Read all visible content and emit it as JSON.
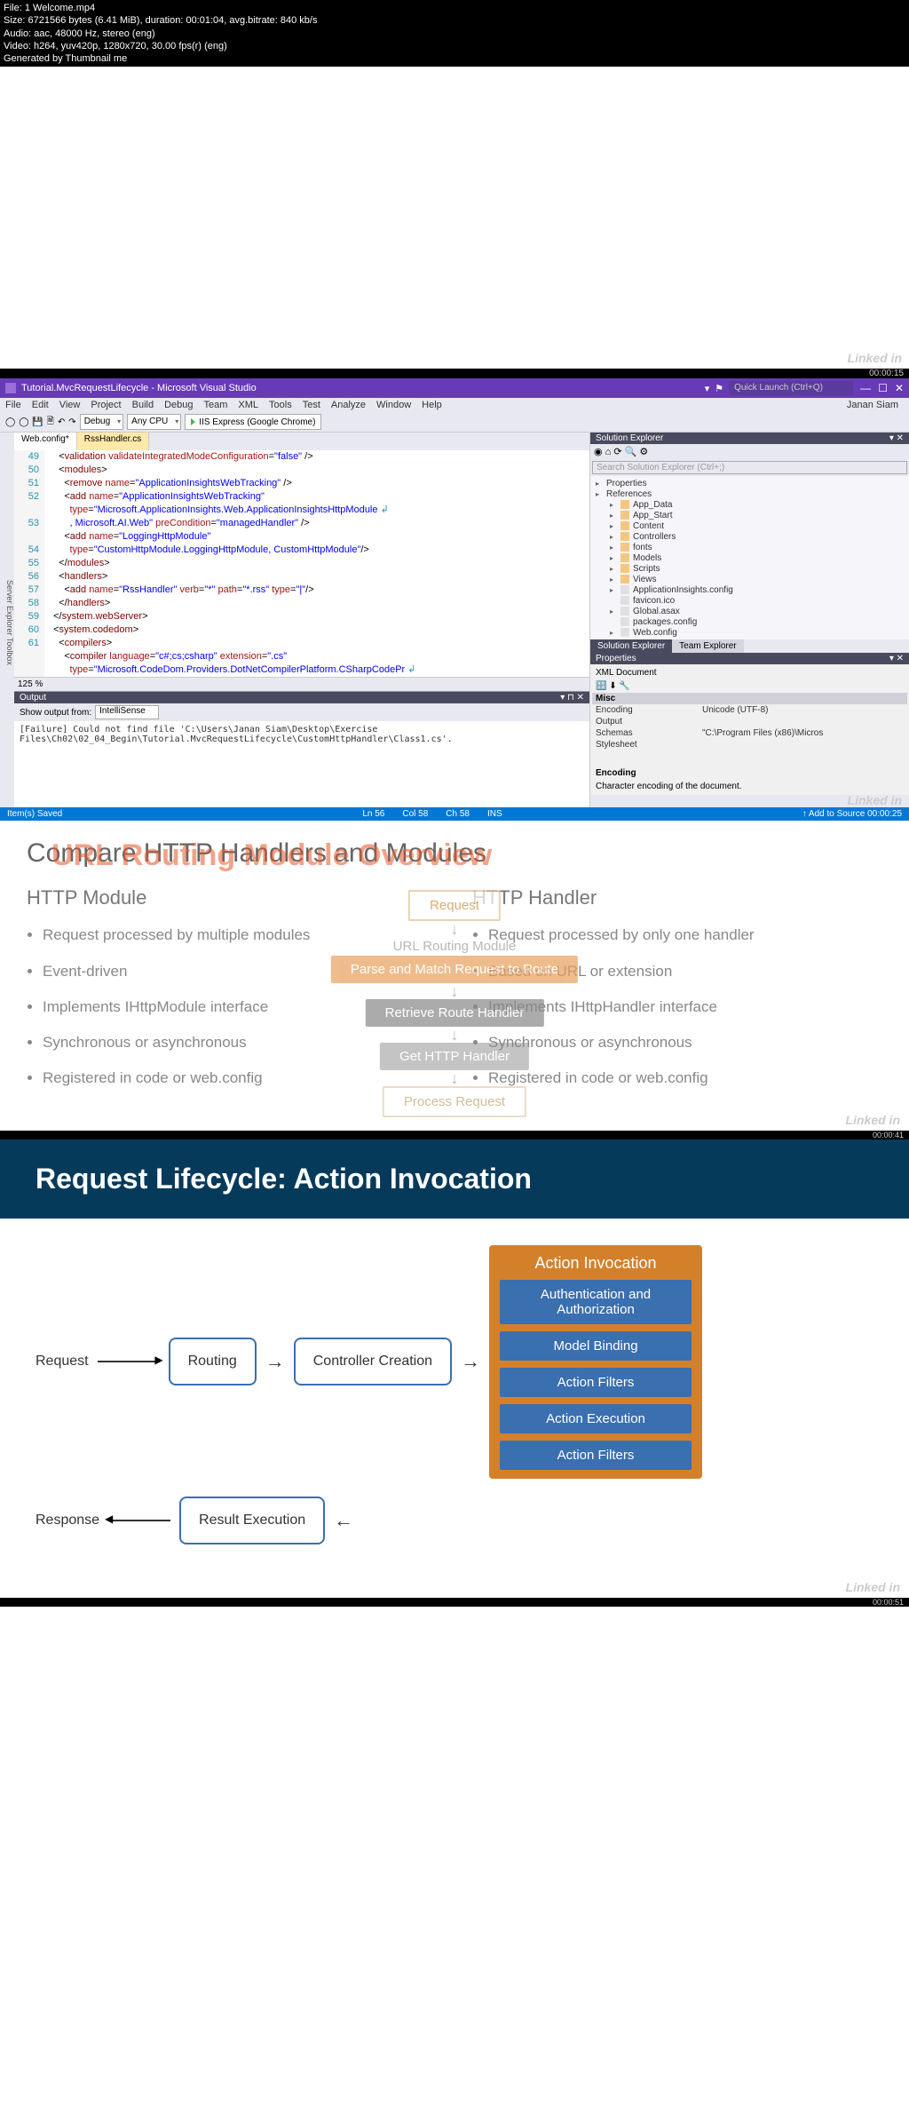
{
  "meta": {
    "file": "File: 1 Welcome.mp4",
    "size": "Size: 6721566 bytes (6.41 MiB), duration: 00:01:04, avg.bitrate: 840 kb/s",
    "audio": "Audio: aac, 48000 Hz, stereo (eng)",
    "video": "Video: h264, yuv420p, 1280x720, 30.00 fps(r) (eng)",
    "gen": "Generated by Thumbnail me",
    "ts1": "00:00:15"
  },
  "vs": {
    "title": "Tutorial.MvcRequestLifecycle - Microsoft Visual Studio",
    "quick_launch": "Quick Launch (Ctrl+Q)",
    "user": "Janan Siam",
    "menu": [
      "File",
      "Edit",
      "View",
      "Project",
      "Build",
      "Debug",
      "Team",
      "XML",
      "Tools",
      "Test",
      "Analyze",
      "Window",
      "Help"
    ],
    "config": "Debug",
    "platform": "Any CPU",
    "run": "IIS Express (Google Chrome)",
    "tabs": {
      "t1": "Web.config*",
      "t2": "RssHandler.cs"
    },
    "gutter": [
      "49",
      "50",
      "51",
      "52",
      "",
      "53",
      "",
      "54",
      "55",
      "56",
      "57",
      "58",
      "59",
      "60",
      "61",
      ""
    ],
    "zoom": "125 %",
    "output_title": "Output",
    "output_from_label": "Show output from:",
    "output_from": "IntelliSense",
    "output_text": "[Failure] Could not find file 'C:\\Users\\Janan Siam\\Desktop\\Exercise Files\\Ch02\\02_04_Begin\\Tutorial.MvcRequestLifecycle\\CustomHttpHandler\\Class1.cs'.",
    "solution_explorer": "Solution Explorer",
    "search_sln": "Search Solution Explorer (Ctrl+;)",
    "tree": {
      "props": "Properties",
      "refs": "References",
      "appdata": "App_Data",
      "appstart": "App_Start",
      "content": "Content",
      "controllers": "Controllers",
      "fonts": "fonts",
      "models": "Models",
      "scripts": "Scripts",
      "views": "Views",
      "ai": "ApplicationInsights.config",
      "fav": "favicon.ico",
      "global": "Global.asax",
      "pkg": "packages.config",
      "web": "Web.config"
    },
    "panel_tabs": {
      "sln": "Solution Explorer",
      "team": "Team Explorer"
    },
    "properties": "Properties",
    "props_doc": "XML Document",
    "props_misc": "Misc",
    "props_enc_label": "Encoding",
    "props_enc_val": "Unicode (UTF-8)",
    "props_out_label": "Output",
    "props_out_val": "",
    "props_schema_label": "Schemas",
    "props_schema_val": "\"C:\\Program Files (x86)\\Micros",
    "props_style_label": "Stylesheet",
    "props_footer_head": "Encoding",
    "props_footer_text": "Character encoding of the document.",
    "status_saved": "Item(s) Saved",
    "status_ln": "Ln 56",
    "status_col": "Col 58",
    "status_ch": "Ch 58",
    "status_ins": "INS",
    "status_add": "↑ Add to Source  00:00:25",
    "wm": "Linked in"
  },
  "slide2": {
    "title": "Compare HTTP Handlers and Modules",
    "overlay": "URL Routing Module Overview",
    "col1_head": "HTTP Module",
    "col2_head": "HTTP Handler",
    "col1": [
      "Request processed by multiple modules",
      "Event-driven",
      "Implements IHttpModule interface",
      "Synchronous or asynchronous",
      "Registered in code or web.config"
    ],
    "col2": [
      "Request processed by only one handler",
      "Based on URL or extension",
      "Implements IHttpHandler interface",
      "Synchronous or asynchronous",
      "Registered in code or web.config"
    ],
    "flow": {
      "req": "Request",
      "urlmod": "URL Routing Module",
      "parse": "Parse and Match Request to Route",
      "retrieve": "Retrieve Route Handler",
      "gethandler": "Get HTTP Handler",
      "process": "Process Request"
    },
    "wm": "Linked in",
    "ts": "00:00:41"
  },
  "slide3": {
    "title": "Request Lifecycle: Action Invocation",
    "req": "Request",
    "routing": "Routing",
    "controller": "Controller Creation",
    "panel_head": "Action Invocation",
    "steps": [
      "Authentication and Authorization",
      "Model Binding",
      "Action Filters",
      "Action Execution",
      "Action Filters"
    ],
    "resp": "Response",
    "result": "Result Execution",
    "wm": "Linked in",
    "ts": "00:00:51"
  }
}
